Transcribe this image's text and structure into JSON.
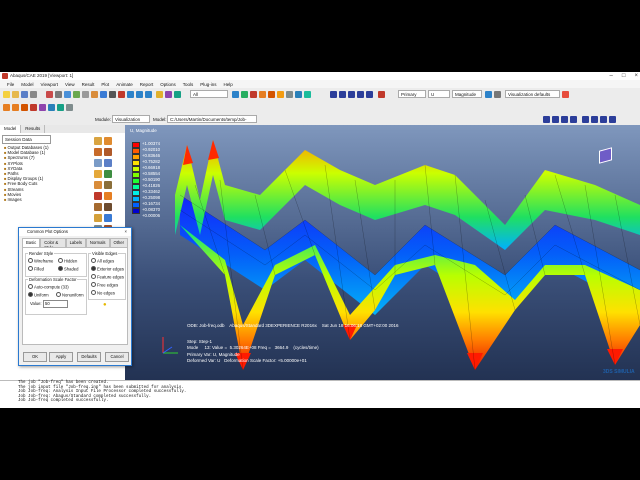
{
  "window": {
    "title": "Abaqus/CAE 2019 [Viewport: 1]"
  },
  "menu": [
    "File",
    "Model",
    "Viewport",
    "View",
    "Result",
    "Plot",
    "Animate",
    "Report",
    "Options",
    "Tools",
    "Plug-ins",
    "Help"
  ],
  "toolbar": {
    "step_select": "All",
    "primary_select": "Primary",
    "u_select": "U",
    "magnitude_select": "Magnitude",
    "vis_defaults": "Visualization defaults"
  },
  "context": {
    "module_label": "Module:",
    "module_value": "Visualization",
    "model_label": "Model:",
    "model_value": "C:/Users/Martin/Documents/temp/Job-freq.odb"
  },
  "left_panel": {
    "tabs": [
      "Model",
      "Results"
    ],
    "session_select": "Session Data",
    "tree": [
      "Output Databases (1)",
      "Model Database (1)",
      "Spectrums (7)",
      "XYPlots",
      "XYData",
      "Paths",
      "Display Groups (1)",
      "Free Body Cuts",
      "Streams",
      "Movies",
      "Images"
    ]
  },
  "legend": {
    "title": "U, Magnitude",
    "values": [
      "+1.00374",
      "+0.92010",
      "+0.83646",
      "+0.75282",
      "+0.66918",
      "+0.58554",
      "+0.50190",
      "+0.41826",
      "+0.33462",
      "+0.25098",
      "+0.16734",
      "+0.08370",
      "+0.00006"
    ],
    "colors": [
      "#ff0000",
      "#ff5a00",
      "#ffa300",
      "#ffe100",
      "#ccff00",
      "#7fff00",
      "#20ff30",
      "#00ff9a",
      "#00f0e8",
      "#00b0ff",
      "#0060ff",
      "#0020ff",
      "#0000d0"
    ]
  },
  "viewport": {
    "odb_line": "ODB: Job-freq.odb    Abaqus/Standard 3DEXPERIENCE R2016x    Sat Jun 18 16:06:18 GMT+02:00 2016",
    "step_line": "Step: Step-1",
    "mode_line": "Mode     13: Value =  5.30264E+08 Freq =   3664.9    (cycles/time)",
    "primary_line": "Primary Var: U, Magnitude",
    "deformed_line": "Deformed Var: U   Deformation Scale Factor: +5.00000e+01"
  },
  "dialog": {
    "title": "Common Plot Options",
    "tabs": [
      "Basic",
      "Color & Style",
      "Labels",
      "Normals",
      "Other"
    ],
    "render_style_title": "Render Style",
    "render_options": [
      "Wireframe",
      "Hidden",
      "Filled",
      "Shaded"
    ],
    "visible_edges_title": "Visible Edges",
    "edge_options": [
      "All edges",
      "Exterior edges",
      "Feature edges",
      "Free edges",
      "No edges"
    ],
    "deform_title": "Deformation Scale Factor",
    "deform_options": [
      "Auto-compute (33)",
      "Uniform",
      "Nonuniform"
    ],
    "value_label": "Value:",
    "value": "50",
    "buttons": [
      "OK",
      "Apply",
      "Defaults",
      "Cancel"
    ]
  },
  "messages": [
    "The job \"Job-freq\" has been created.",
    "The job input file \"Job-freq.inp\" has been submitted for analysis.",
    "Job Job-freq: Analysis Input File Processor completed successfully.",
    "Job Job-freq: Abaqus/Standard completed successfully.",
    "Job Job-freq completed successfully."
  ],
  "brand": "3DS SIMULIA"
}
